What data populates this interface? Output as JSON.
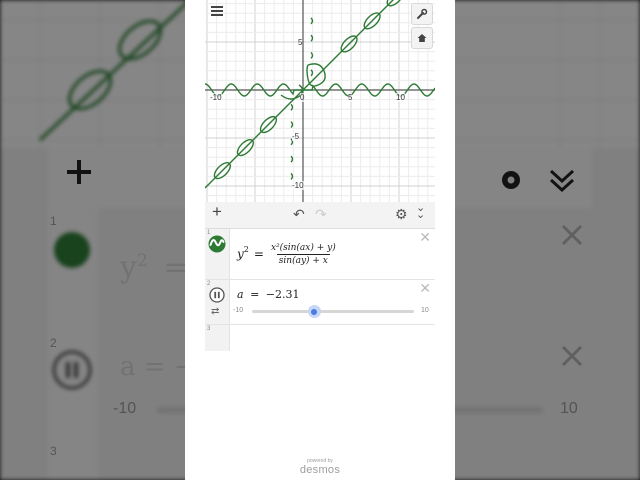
{
  "colors": {
    "curve": "#2d7a35",
    "grid_minor": "#ececec",
    "grid_major": "#d0d0d0",
    "axis": "#555555",
    "slider_thumb": "#4a7de0",
    "slider_halo": "#c6d6f6",
    "track": "#d6d6d6"
  },
  "graph": {
    "x_tick_labels": [
      "-10",
      "0",
      "5",
      "10"
    ],
    "y_tick_labels": [
      "5",
      "-5",
      "-10"
    ]
  },
  "expressions": [
    {
      "index": "1",
      "icon": "desmos-curve-icon",
      "lhs": "y",
      "lhs_exp": "2",
      "equals": "=",
      "numerator": "x²(sin(ax) + y)",
      "denominator": "sin(ay) + x"
    },
    {
      "index": "2",
      "icon": "pause-icon",
      "variable": "a",
      "equals": "=",
      "value": "−2.31",
      "slider": {
        "min": "-10",
        "max": "10",
        "value": -2.31
      }
    },
    {
      "index": "3"
    }
  ],
  "background": {
    "index_1": "1",
    "index_2": "2",
    "index_3": "3",
    "eq_lhs": "y",
    "eq_exp": "2",
    "eq_rest": "=",
    "slider_text": "a = −",
    "slider_min": "-10",
    "slider_max": "10"
  },
  "branding": {
    "powered_by": "powered by",
    "name": "desmos"
  }
}
